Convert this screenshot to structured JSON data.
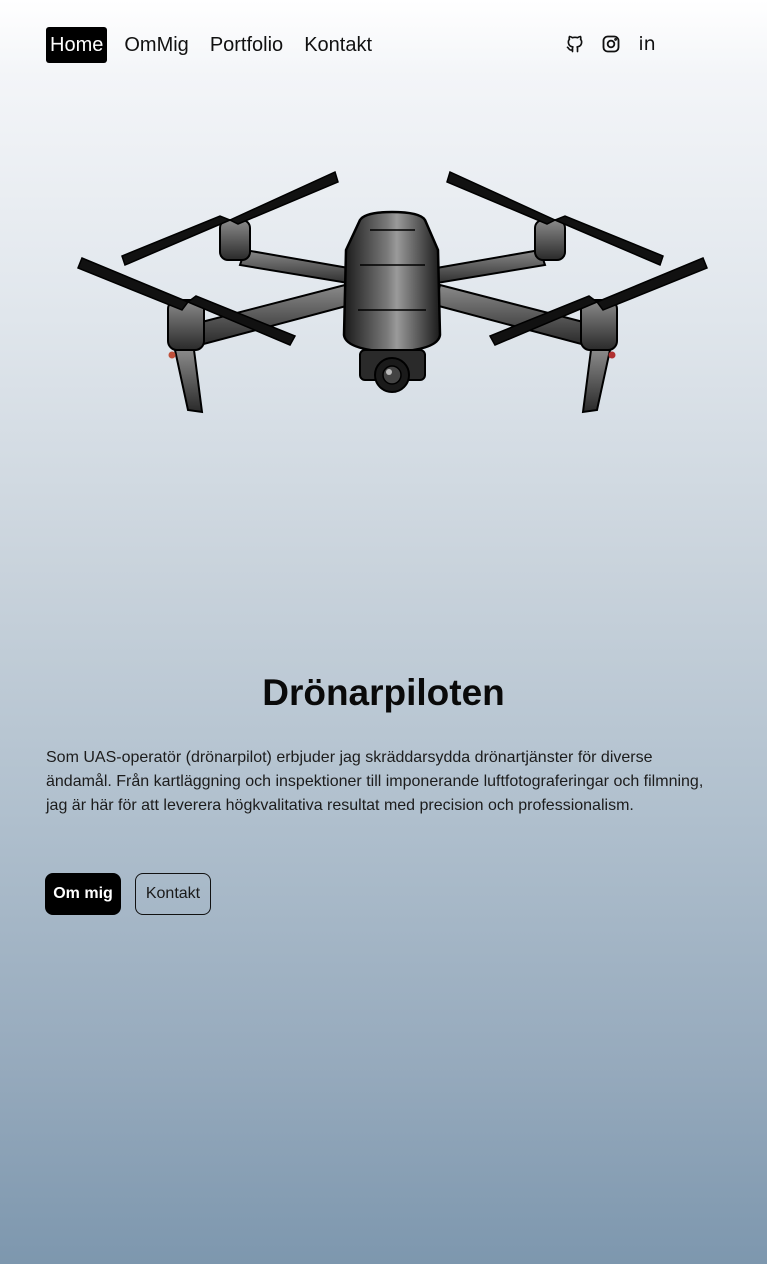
{
  "nav": {
    "items": [
      {
        "label": "Home",
        "active": true
      },
      {
        "label": "OmMig",
        "active": false
      },
      {
        "label": "Portfolio",
        "active": false
      },
      {
        "label": "Kontakt",
        "active": false
      }
    ]
  },
  "social": {
    "icons": [
      "github-icon",
      "instagram-icon",
      "linkedin-icon"
    ],
    "linkedin_label": "in"
  },
  "hero": {
    "title": "Drönarpiloten",
    "description": "Som UAS-operatör (drönarpilot) erbjuder jag skräddarsydda drönartjänster för diverse ändamål. Från kartläggning och inspektioner till imponerande luftfotograferingar och filmning, jag är här för att leverera högkvalitativa resultat med precision och professionalism.",
    "primary_button": "Om mig",
    "secondary_button": "Kontakt"
  },
  "colors": {
    "accent": "#000000",
    "gradient_top": "#ffffff",
    "gradient_bottom": "#7d97ae"
  }
}
